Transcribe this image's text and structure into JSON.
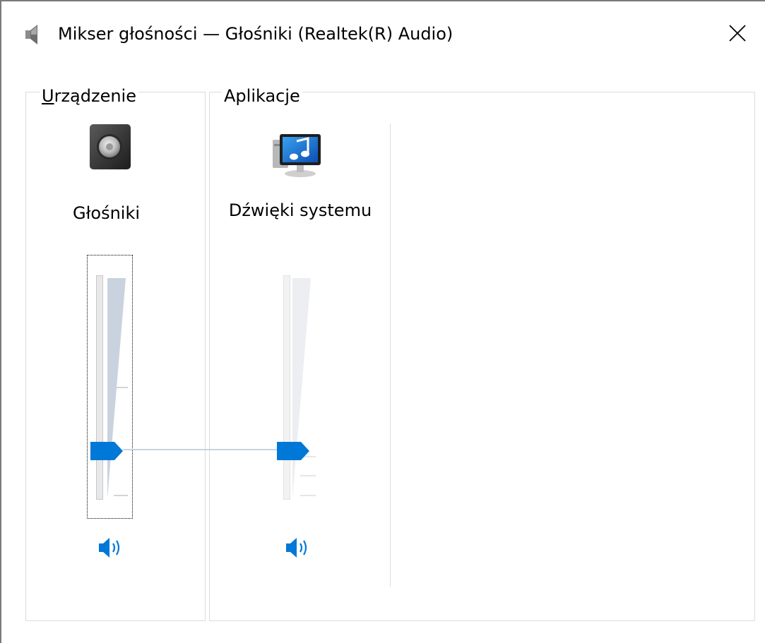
{
  "window": {
    "title": "Mikser głośności — Głośniki (Realtek(R) Audio)"
  },
  "device_group": {
    "label_mnemonic": "U",
    "label_rest": "rządzenie",
    "channel": {
      "name": "Głośniki",
      "icon": "speaker-icon",
      "volume_percent": 20,
      "mute_icon": "speaker-volume-icon"
    }
  },
  "apps_group": {
    "label": "Aplikacje",
    "channels": [
      {
        "name": "Dźwięki systemu",
        "icon": "system-sounds-icon",
        "volume_percent": 20,
        "mute_icon": "speaker-volume-icon"
      }
    ]
  },
  "colors": {
    "accent": "#0078d7",
    "slider_fill": "#c9d3df"
  }
}
